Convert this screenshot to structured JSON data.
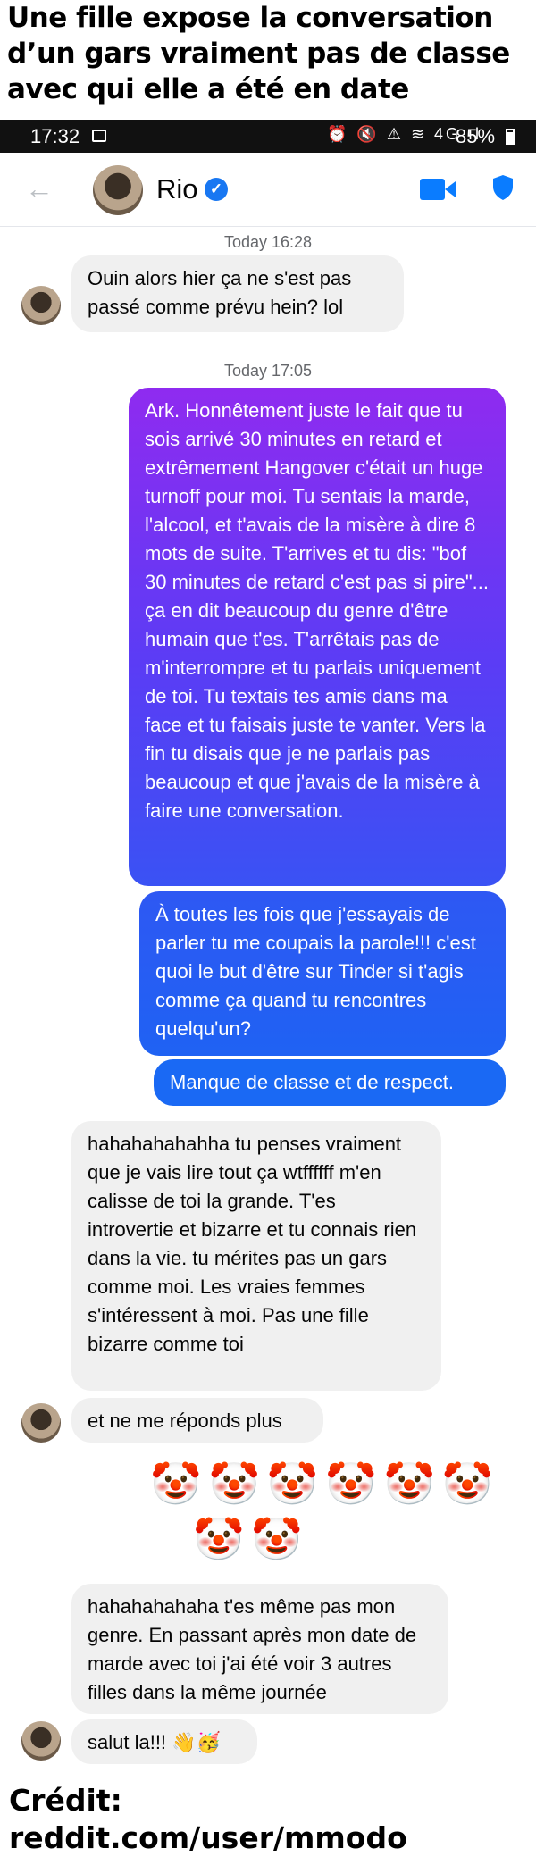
{
  "headline": "Une fille expose la conversation d’un gars vraiment pas de classe avec qui elle a été en date",
  "status_bar": {
    "time": "17:32",
    "indicators": "⏰ 🔇 ⚠ ≋ 4G ıl",
    "battery": "85%"
  },
  "header": {
    "contact_name": "Rio",
    "verified_glyph": "✓",
    "back_glyph": "←"
  },
  "messages": {
    "ts1": "Today 16:28",
    "m1": "Ouin alors hier ça ne s'est pas passé comme prévu hein? lol",
    "ts2": "Today 17:05",
    "m2": "Ark. Honnêtement juste le fait que tu sois arrivé 30 minutes en retard et extrêmement Hangover c'était un huge turnoff pour moi. Tu sentais la marde, l'alcool, et t'avais de la misère à dire 8 mots de suite. T'arrives et tu dis: \"bof 30 minutes de retard c'est pas si pire\"... ça en dit beaucoup du genre d'être humain que t'es. T'arrêtais pas de m'interrompre et tu parlais uniquement de toi. Tu textais tes amis dans ma face et tu faisais juste te vanter. Vers la fin tu disais que je ne parlais pas beaucoup et que j'avais de la misère à faire une conversation.",
    "m3": "À toutes les fois que j'essayais de parler tu me coupais la parole!!! c'est quoi le but d'être sur Tinder si t'agis comme ça quand tu rencontres quelqu'un?",
    "m4": "Manque de classe et de respect.",
    "m5": "hahahahahahha tu penses vraiment que je vais lire tout ça wtffffff m'en calisse de toi la grande. T'es introvertie et bizarre et tu connais rien dans la vie. tu mérites pas un gars comme moi. Les vraies femmes s'intéressent à moi. Pas une fille bizarre comme toi",
    "m6": "et ne me réponds plus",
    "emoji_row1": "🤡🤡🤡🤡🤡🤡",
    "emoji_row2": "🤡🤡",
    "m7": "hahahahahaha t'es même pas mon genre. En passant après mon date de marde avec toi j'ai été voir 3 autres filles dans la même journée",
    "m8": "salut la!!! 👋🥳"
  },
  "credit": "Crédit: reddit.com/user/mmodo",
  "colors": {
    "accent": "#0a7cff",
    "gradient_top": "#8f2bf0",
    "gradient_mid": "#5b3cf5",
    "gradient_bottom": "#1f62f3",
    "incoming_bubble": "#f0f0f0"
  }
}
